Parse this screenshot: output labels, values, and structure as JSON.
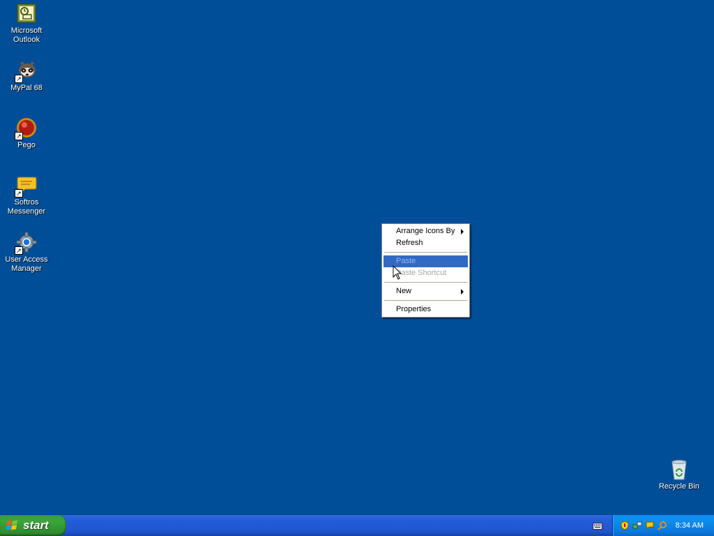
{
  "desktop": {
    "background_color": "#004e98",
    "icons": [
      {
        "label": "Microsoft\nOutlook",
        "icon": "outlook-icon"
      },
      {
        "label": "MyPal 68",
        "icon": "mypal-icon"
      },
      {
        "label": "Pego",
        "icon": "pego-icon"
      },
      {
        "label": "Softros\nMessenger",
        "icon": "softros-messenger-icon"
      },
      {
        "label": "User Access\nManager",
        "icon": "user-access-manager-icon"
      },
      {
        "label": "Recycle Bin",
        "icon": "recycle-bin-icon"
      }
    ]
  },
  "context_menu": {
    "items": [
      {
        "label": "Arrange Icons By",
        "submenu": true,
        "enabled": true
      },
      {
        "label": "Refresh",
        "submenu": false,
        "enabled": true
      },
      {
        "label": "Paste",
        "submenu": false,
        "enabled": false,
        "highlighted": true
      },
      {
        "label": "Paste Shortcut",
        "submenu": false,
        "enabled": false
      },
      {
        "label": "New",
        "submenu": true,
        "enabled": true
      },
      {
        "label": "Properties",
        "submenu": false,
        "enabled": true
      }
    ],
    "highlight_color": "#316ac5"
  },
  "taskbar": {
    "start_label": "start",
    "clock": "8:34 AM",
    "tray_icons": [
      "security-shield-icon",
      "network-icon",
      "messenger-tray-icon",
      "search-tray-icon"
    ],
    "language_icon": "keyboard-icon"
  }
}
